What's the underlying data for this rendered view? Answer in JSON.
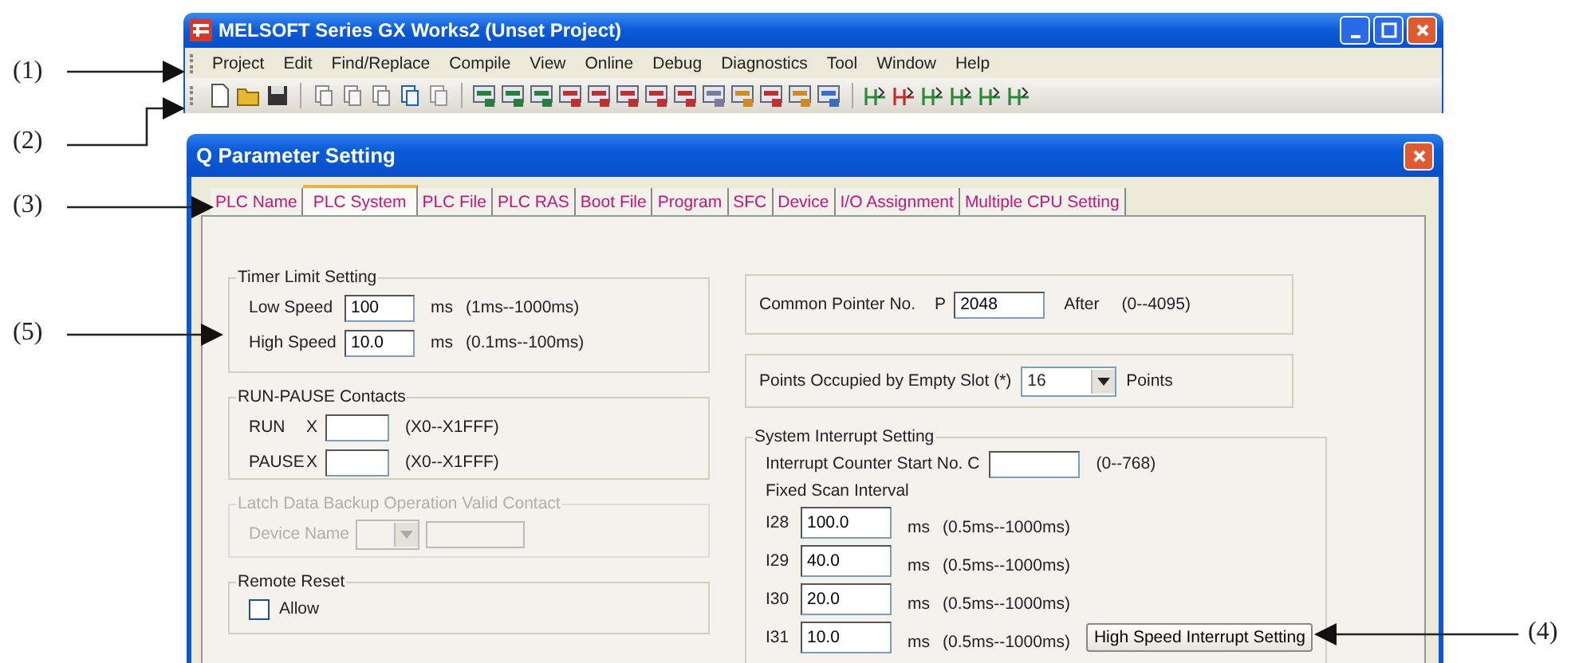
{
  "main_window": {
    "title": "MELSOFT Series GX Works2 (Unset Project)",
    "menu": [
      "Project",
      "Edit",
      "Find/Replace",
      "Compile",
      "View",
      "Online",
      "Debug",
      "Diagnostics",
      "Tool",
      "Window",
      "Help"
    ]
  },
  "dialog": {
    "title": "Q Parameter Setting",
    "tabs": [
      {
        "label": "PLC Name",
        "selected": false
      },
      {
        "label": "PLC System",
        "selected": true
      },
      {
        "label": "PLC File",
        "selected": false
      },
      {
        "label": "PLC RAS",
        "selected": false
      },
      {
        "label": "Boot File",
        "selected": false
      },
      {
        "label": "Program",
        "selected": false
      },
      {
        "label": "SFC",
        "selected": false
      },
      {
        "label": "Device",
        "selected": false
      },
      {
        "label": "I/O Assignment",
        "selected": false
      },
      {
        "label": "Multiple CPU Setting",
        "selected": false
      }
    ],
    "timer_limit": {
      "title": "Timer Limit Setting",
      "rows": [
        {
          "label": "Low Speed",
          "value": "100",
          "unit": "ms",
          "range": "(1ms--1000ms)"
        },
        {
          "label": "High Speed",
          "value": "10.0",
          "unit": "ms",
          "range": "(0.1ms--100ms)"
        }
      ]
    },
    "run_pause": {
      "title": "RUN-PAUSE Contacts",
      "rows": [
        {
          "label": "RUN",
          "prefix": "X",
          "range": "(X0--X1FFF)"
        },
        {
          "label": "PAUSE",
          "prefix": "X",
          "range": "(X0--X1FFF)"
        }
      ]
    },
    "latch": {
      "title": "Latch Data Backup Operation Valid Contact",
      "disabled": true,
      "device_label": "Device Name"
    },
    "remote_reset": {
      "title": "Remote Reset",
      "allow": {
        "label": "Allow",
        "checked": false
      }
    },
    "common_pointer": {
      "label": "Common Pointer No.",
      "prefix": "P",
      "value": "2048",
      "suffix": "After",
      "range": "(0--4095)"
    },
    "empty_slot": {
      "label": "Points Occupied by Empty Slot (*)",
      "value": "16",
      "unit": "Points"
    },
    "system_interrupt": {
      "title": "System Interrupt Setting",
      "counter": {
        "label": "Interrupt Counter Start No. C",
        "range": "(0--768)"
      },
      "fixed_scan_label": "Fixed Scan Interval",
      "rows": [
        {
          "label": "I28",
          "value": "100.0",
          "unit": "ms",
          "range": "(0.5ms--1000ms)"
        },
        {
          "label": "I29",
          "value": "40.0",
          "unit": "ms",
          "range": "(0.5ms--1000ms)"
        },
        {
          "label": "I30",
          "value": "20.0",
          "unit": "ms",
          "range": "(0.5ms--1000ms)"
        },
        {
          "label": "I31",
          "value": "10.0",
          "unit": "ms",
          "range": "(0.5ms--1000ms)"
        }
      ],
      "button": "High Speed Interrupt Setting"
    }
  },
  "callouts": [
    "(1)",
    "(2)",
    "(3)",
    "(5)",
    "(4)"
  ]
}
